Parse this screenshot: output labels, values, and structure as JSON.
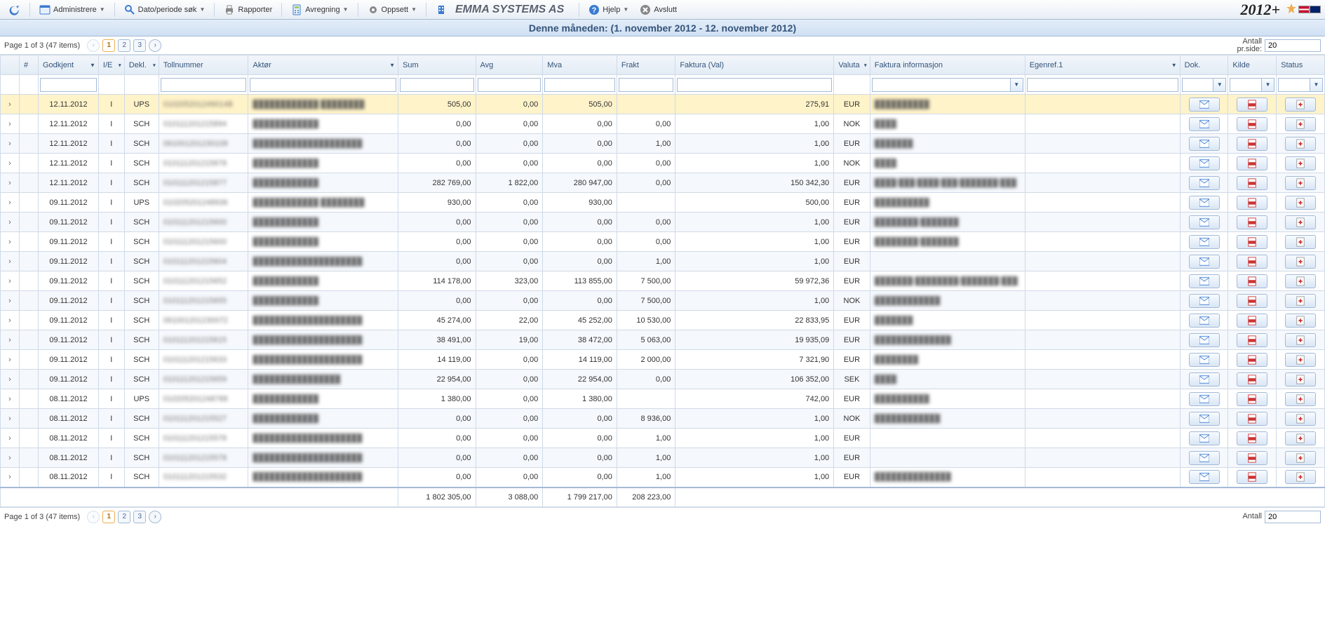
{
  "toolbar": {
    "administrere": "Administrere",
    "datosok": "Dato/periode søk",
    "rapporter": "Rapporter",
    "avregning": "Avregning",
    "oppsett": "Oppsett",
    "company": "EMMA SYSTEMS AS",
    "hjelp": "Hjelp",
    "avslutt": "Avslutt",
    "brand": "2012+"
  },
  "titlebar": "Denne måneden: (1. november 2012 - 12. november 2012)",
  "pager": {
    "status": "Page 1 of 3 (47 items)",
    "pages": [
      "1",
      "2",
      "3"
    ],
    "active_page": "1",
    "perside_label_line1": "Antall",
    "perside_label_line2": "pr.side:",
    "perside_value": "20"
  },
  "columns": {
    "hash": "#",
    "godkjent": "Godkjent",
    "ie": "I/E",
    "dekl": "Dekl.",
    "tollnummer": "Tollnummer",
    "aktor": "Aktør",
    "sum": "Sum",
    "avg": "Avg",
    "mva": "Mva",
    "frakt": "Frakt",
    "faktura_val": "Faktura (Val)",
    "valuta": "Valuta",
    "faktura_info": "Faktura informasjon",
    "egenref": "Egenref.1",
    "dok": "Dok.",
    "kilde": "Kilde",
    "status": "Status"
  },
  "rows": [
    {
      "sel": true,
      "godkjent": "12.11.2012",
      "ie": "I",
      "dekl": "UPS",
      "toll": "010205201249014B",
      "aktor": "████████████ ████████",
      "sum": "505,00",
      "avg": "0,00",
      "mva": "505,00",
      "frakt": "",
      "fval": "275,91",
      "valuta": "EUR",
      "finfo": "██████████"
    },
    {
      "godkjent": "12.11.2012",
      "ie": "I",
      "dekl": "SCH",
      "toll": "010111201215894",
      "aktor": "████████████",
      "sum": "0,00",
      "avg": "0,00",
      "mva": "0,00",
      "frakt": "0,00",
      "fval": "1,00",
      "valuta": "NOK",
      "finfo": "████"
    },
    {
      "godkjent": "12.11.2012",
      "ie": "I",
      "dekl": "SCH",
      "toll": "061001201230108",
      "aktor": "████████████████████",
      "sum": "0,00",
      "avg": "0,00",
      "mva": "0,00",
      "frakt": "1,00",
      "fval": "1,00",
      "valuta": "EUR",
      "finfo": "███████"
    },
    {
      "godkjent": "12.11.2012",
      "ie": "I",
      "dekl": "SCH",
      "toll": "010111201215878",
      "aktor": "████████████",
      "sum": "0,00",
      "avg": "0,00",
      "mva": "0,00",
      "frakt": "0,00",
      "fval": "1,00",
      "valuta": "NOK",
      "finfo": "████"
    },
    {
      "godkjent": "12.11.2012",
      "ie": "I",
      "dekl": "SCH",
      "toll": "010111201215877",
      "aktor": "████████████",
      "sum": "282 769,00",
      "avg": "1 822,00",
      "mva": "280 947,00",
      "frakt": "0,00",
      "fval": "150 342,30",
      "valuta": "EUR",
      "finfo": "████/███/████/███/███████/███"
    },
    {
      "godkjent": "09.11.2012",
      "ie": "I",
      "dekl": "UPS",
      "toll": "010205201248936",
      "aktor": "████████████ ████████",
      "sum": "930,00",
      "avg": "0,00",
      "mva": "930,00",
      "frakt": "",
      "fval": "500,00",
      "valuta": "EUR",
      "finfo": "██████████"
    },
    {
      "godkjent": "09.11.2012",
      "ie": "I",
      "dekl": "SCH",
      "toll": "010111201215600",
      "aktor": "████████████",
      "sum": "0,00",
      "avg": "0,00",
      "mva": "0,00",
      "frakt": "0,00",
      "fval": "1,00",
      "valuta": "EUR",
      "finfo": "████████/███████"
    },
    {
      "godkjent": "09.11.2012",
      "ie": "I",
      "dekl": "SCH",
      "toll": "010111201215600",
      "aktor": "████████████",
      "sum": "0,00",
      "avg": "0,00",
      "mva": "0,00",
      "frakt": "0,00",
      "fval": "1,00",
      "valuta": "EUR",
      "finfo": "████████/███████"
    },
    {
      "godkjent": "09.11.2012",
      "ie": "I",
      "dekl": "SCH",
      "toll": "010111201215604",
      "aktor": "████████████████████",
      "sum": "0,00",
      "avg": "0,00",
      "mva": "0,00",
      "frakt": "1,00",
      "fval": "1,00",
      "valuta": "EUR",
      "finfo": ""
    },
    {
      "godkjent": "09.11.2012",
      "ie": "I",
      "dekl": "SCH",
      "toll": "010111201215652",
      "aktor": "████████████",
      "sum": "114 178,00",
      "avg": "323,00",
      "mva": "113 855,00",
      "frakt": "7 500,00",
      "fval": "59 972,36",
      "valuta": "EUR",
      "finfo": "███████/████████/███████/███"
    },
    {
      "godkjent": "09.11.2012",
      "ie": "I",
      "dekl": "SCH",
      "toll": "010111201215655",
      "aktor": "████████████",
      "sum": "0,00",
      "avg": "0,00",
      "mva": "0,00",
      "frakt": "7 500,00",
      "fval": "1,00",
      "valuta": "NOK",
      "finfo": "████████████"
    },
    {
      "godkjent": "09.11.2012",
      "ie": "I",
      "dekl": "SCH",
      "toll": "061001201230072",
      "aktor": "████████████████████",
      "sum": "45 274,00",
      "avg": "22,00",
      "mva": "45 252,00",
      "frakt": "10 530,00",
      "fval": "22 833,95",
      "valuta": "EUR",
      "finfo": "███████"
    },
    {
      "godkjent": "09.11.2012",
      "ie": "I",
      "dekl": "SCH",
      "toll": "010111201215615",
      "aktor": "████████████████████",
      "sum": "38 491,00",
      "avg": "19,00",
      "mva": "38 472,00",
      "frakt": "5 063,00",
      "fval": "19 935,09",
      "valuta": "EUR",
      "finfo": "██████████████"
    },
    {
      "godkjent": "09.11.2012",
      "ie": "I",
      "dekl": "SCH",
      "toll": "010111201215633",
      "aktor": "████████████████████",
      "sum": "14 119,00",
      "avg": "0,00",
      "mva": "14 119,00",
      "frakt": "2 000,00",
      "fval": "7 321,90",
      "valuta": "EUR",
      "finfo": "████████"
    },
    {
      "godkjent": "09.11.2012",
      "ie": "I",
      "dekl": "SCH",
      "toll": "010111201215659",
      "aktor": "████████████████",
      "sum": "22 954,00",
      "avg": "0,00",
      "mva": "22 954,00",
      "frakt": "0,00",
      "fval": "106 352,00",
      "valuta": "SEK",
      "finfo": "████"
    },
    {
      "godkjent": "08.11.2012",
      "ie": "I",
      "dekl": "UPS",
      "toll": "010205201248788",
      "aktor": "████████████",
      "sum": "1 380,00",
      "avg": "0,00",
      "mva": "1 380,00",
      "frakt": "",
      "fval": "742,00",
      "valuta": "EUR",
      "finfo": "██████████"
    },
    {
      "godkjent": "08.11.2012",
      "ie": "I",
      "dekl": "SCH",
      "toll": "010111201215527",
      "aktor": "████████████",
      "sum": "0,00",
      "avg": "0,00",
      "mva": "0,00",
      "frakt": "8 936,00",
      "fval": "1,00",
      "valuta": "NOK",
      "finfo": "████████████"
    },
    {
      "godkjent": "08.11.2012",
      "ie": "I",
      "dekl": "SCH",
      "toll": "010111201215578",
      "aktor": "████████████████████",
      "sum": "0,00",
      "avg": "0,00",
      "mva": "0,00",
      "frakt": "1,00",
      "fval": "1,00",
      "valuta": "EUR",
      "finfo": ""
    },
    {
      "godkjent": "08.11.2012",
      "ie": "I",
      "dekl": "SCH",
      "toll": "010111201215578",
      "aktor": "████████████████████",
      "sum": "0,00",
      "avg": "0,00",
      "mva": "0,00",
      "frakt": "1,00",
      "fval": "1,00",
      "valuta": "EUR",
      "finfo": ""
    },
    {
      "godkjent": "08.11.2012",
      "ie": "I",
      "dekl": "SCH",
      "toll": "010111201215532",
      "aktor": "████████████████████",
      "sum": "0,00",
      "avg": "0,00",
      "mva": "0,00",
      "frakt": "1,00",
      "fval": "1,00",
      "valuta": "EUR",
      "finfo": "██████████████"
    }
  ],
  "totals": {
    "sum": "1 802 305,00",
    "avg": "3 088,00",
    "mva": "1 799 217,00",
    "frakt": "208 223,00"
  }
}
